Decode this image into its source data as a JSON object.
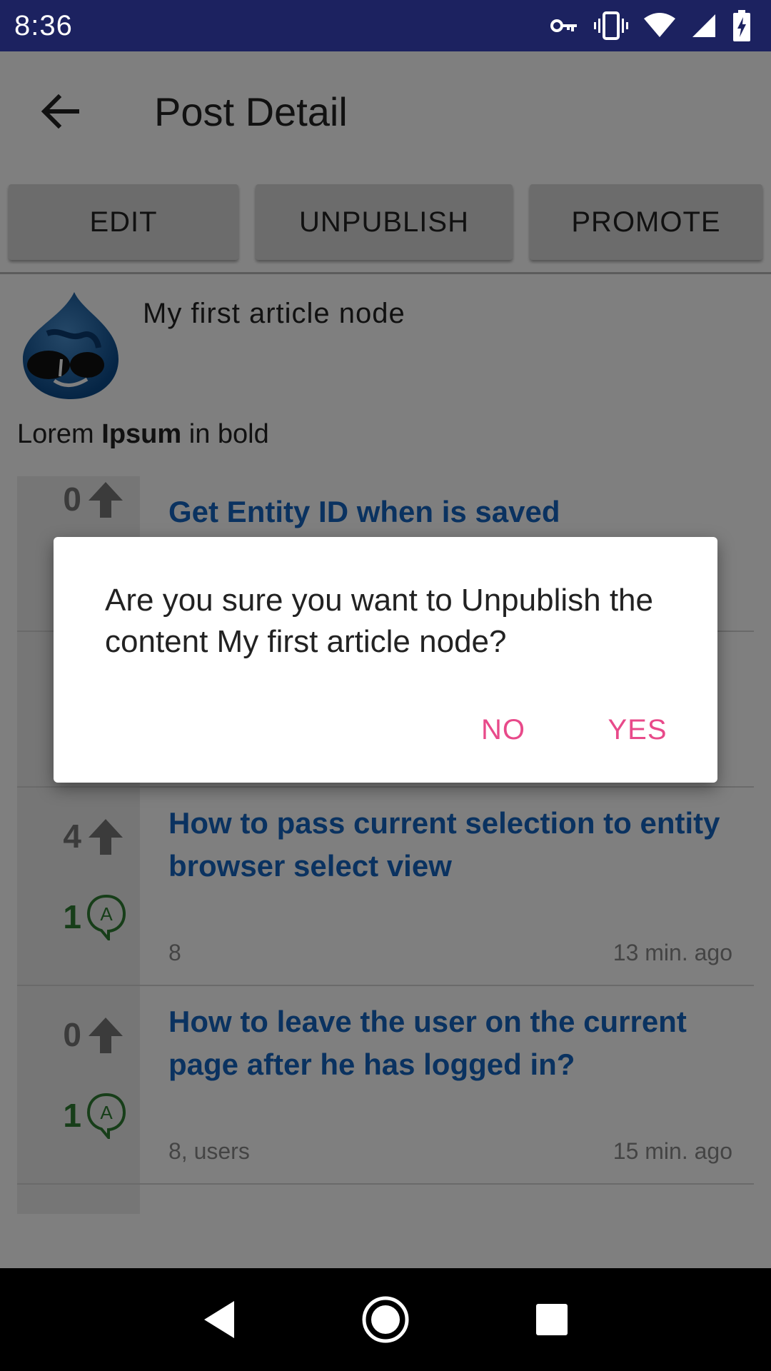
{
  "status_bar": {
    "time": "8:36",
    "icons": [
      "vpn-key-icon",
      "vibrate-icon",
      "wifi-icon",
      "signal-icon",
      "battery-charging-icon"
    ]
  },
  "toolbar": {
    "title": "Post Detail",
    "back_icon": "arrow-back-icon"
  },
  "actions": {
    "edit_label": "EDIT",
    "unpublish_label": "UNPUBLISH",
    "promote_label": "PROMOTE"
  },
  "node": {
    "title": "My first article node",
    "body_prefix": "Lorem ",
    "body_bold": "Ipsum",
    "body_suffix": " in bold"
  },
  "list": [
    {
      "votes": "0",
      "answers": "",
      "title": "Get Entity ID when is saved",
      "tags": "",
      "time": ""
    },
    {
      "votes": "",
      "answers": "",
      "title": "",
      "tags": "",
      "time": ""
    },
    {
      "votes": "4",
      "answers": "1",
      "title": "How to pass current selection to entity browser select view",
      "tags": "8",
      "time": "13 min. ago"
    },
    {
      "votes": "0",
      "answers": "1",
      "title": "How to leave the user on the current page after he has logged in?",
      "tags": "8, users",
      "time": "15 min. ago"
    }
  ],
  "dialog": {
    "message": "Are you sure you want to Unpublish the content My first article node?",
    "no_label": "NO",
    "yes_label": "YES"
  },
  "colors": {
    "status_bar": "#1c2260",
    "accent": "#e84a8a",
    "link": "#1565c0",
    "answer_green": "#2e7d32"
  }
}
